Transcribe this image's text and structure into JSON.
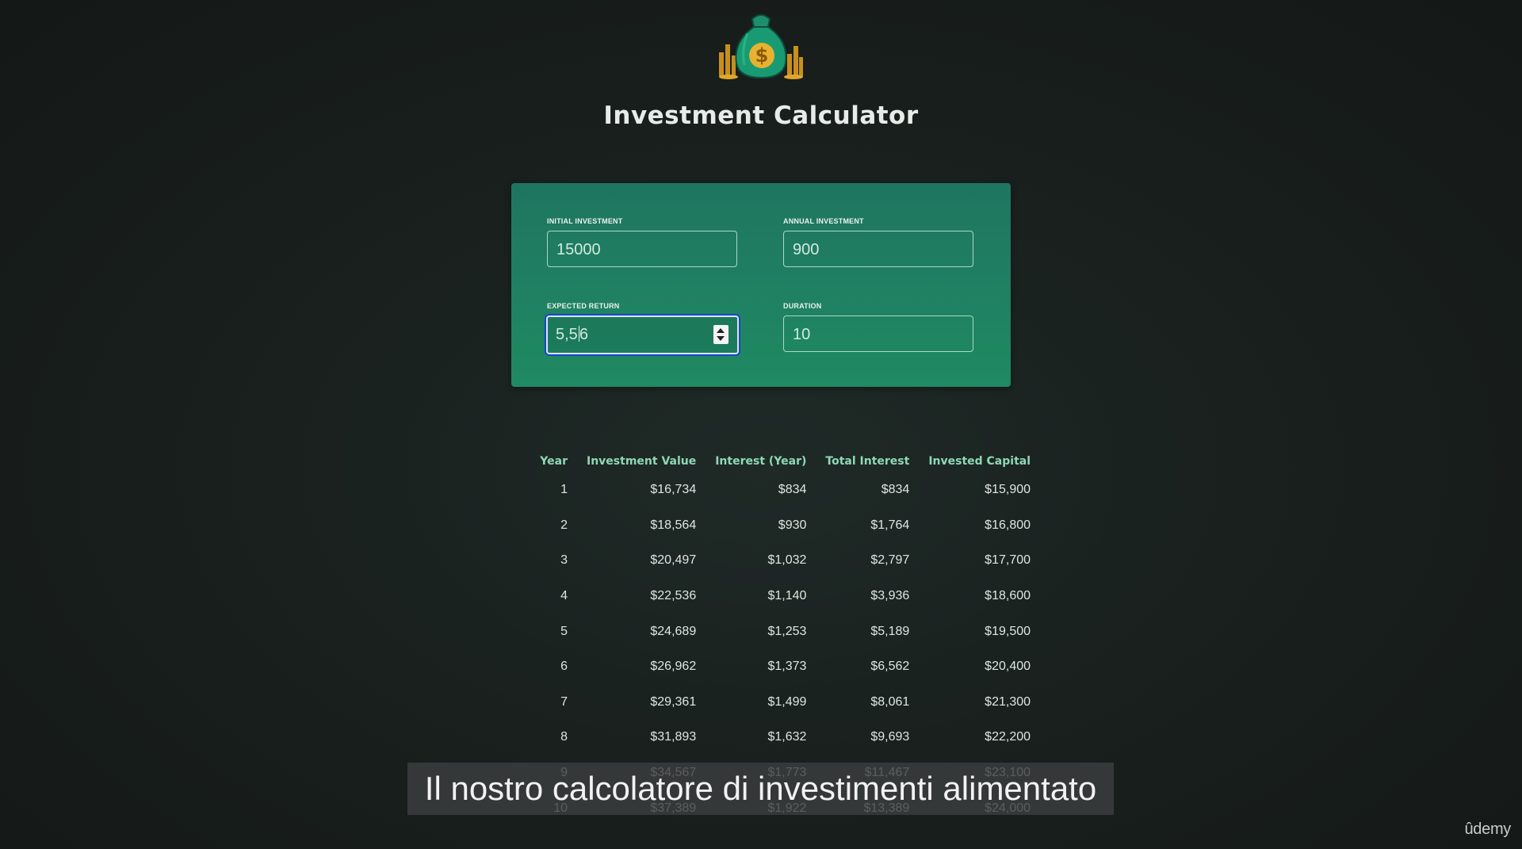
{
  "header": {
    "title": "Investment Calculator",
    "logo_icon": "money-bag-icon"
  },
  "inputs": {
    "initial_investment": {
      "label": "INITIAL INVESTMENT",
      "value": "15000"
    },
    "annual_investment": {
      "label": "ANNUAL INVESTMENT",
      "value": "900"
    },
    "expected_return": {
      "label": "EXPECTED RETURN",
      "value_before_caret": "5,5",
      "value_after_caret": "6"
    },
    "duration": {
      "label": "DURATION",
      "value": "10"
    }
  },
  "results": {
    "headers": [
      "Year",
      "Investment Value",
      "Interest (Year)",
      "Total Interest",
      "Invested Capital"
    ],
    "rows": [
      [
        "1",
        "$16,734",
        "$834",
        "$834",
        "$15,900"
      ],
      [
        "2",
        "$18,564",
        "$930",
        "$1,764",
        "$16,800"
      ],
      [
        "3",
        "$20,497",
        "$1,032",
        "$2,797",
        "$17,700"
      ],
      [
        "4",
        "$22,536",
        "$1,140",
        "$3,936",
        "$18,600"
      ],
      [
        "5",
        "$24,689",
        "$1,253",
        "$5,189",
        "$19,500"
      ],
      [
        "6",
        "$26,962",
        "$1,373",
        "$6,562",
        "$20,400"
      ],
      [
        "7",
        "$29,361",
        "$1,499",
        "$8,061",
        "$21,300"
      ],
      [
        "8",
        "$31,893",
        "$1,632",
        "$9,693",
        "$22,200"
      ],
      [
        "9",
        "$34,567",
        "$1,773",
        "$11,467",
        "$23,100"
      ],
      [
        "10",
        "$37,389",
        "$1,922",
        "$13,389",
        "$24,000"
      ]
    ]
  },
  "subtitle": "Il nostro calcolatore di investimenti alimentato",
  "watermark": "ûdemy",
  "colors": {
    "background": "#19201e",
    "panel": "#1f8063",
    "header_text": "#8fd8b8",
    "focus_ring": "#1a45c8"
  }
}
